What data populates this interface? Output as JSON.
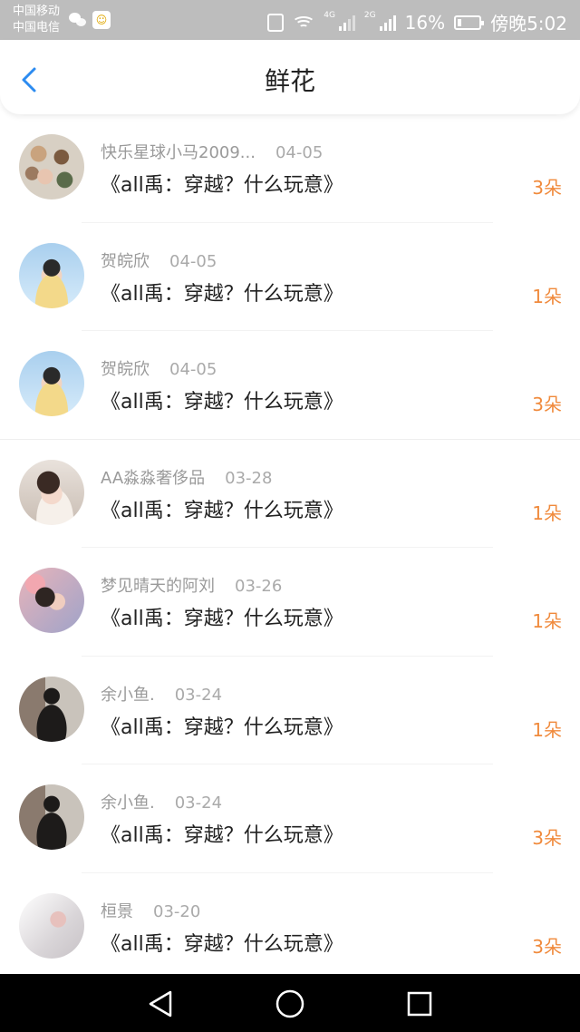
{
  "status_bar": {
    "carrier_1": "中国移动",
    "carrier_2": "中国电信",
    "network_1": "4G",
    "network_2": "2G",
    "battery": "16%",
    "time": "傍晚5:02",
    "icons": [
      "wechat-icon",
      "app-notification-icon",
      "vibrate-icon",
      "wifi-icon",
      "signal-icon",
      "battery-icon"
    ]
  },
  "header": {
    "title": "鲜花",
    "back_icon": "chevron-left-icon",
    "accent": "#2c8bf0"
  },
  "colors": {
    "count": "#f08a3c",
    "meta": "#9a9a9a"
  },
  "records": [
    {
      "user": "快乐星球小马2009...",
      "date": "04-05",
      "book": "《all禹：穿越？什么玩意》",
      "count": "3朵"
    },
    {
      "user": "贺皖欣",
      "date": "04-05",
      "book": "《all禹：穿越？什么玩意》",
      "count": "1朵"
    },
    {
      "user": "贺皖欣",
      "date": "04-05",
      "book": "《all禹：穿越？什么玩意》",
      "count": "3朵"
    },
    {
      "user": "AA淼淼奢侈品",
      "date": "03-28",
      "book": "《all禹：穿越？什么玩意》",
      "count": "1朵"
    },
    {
      "user": "梦见晴天的阿刘",
      "date": "03-26",
      "book": "《all禹：穿越？什么玩意》",
      "count": "1朵"
    },
    {
      "user": "余小鱼.",
      "date": "03-24",
      "book": "《all禹：穿越？什么玩意》",
      "count": "1朵"
    },
    {
      "user": "余小鱼.",
      "date": "03-24",
      "book": "《all禹：穿越？什么玩意》",
      "count": "3朵"
    },
    {
      "user": "桓景",
      "date": "03-20",
      "book": "《all禹：穿越？什么玩意》",
      "count": "3朵"
    }
  ],
  "nav_bar": {
    "icons": [
      "back-triangle-icon",
      "home-circle-icon",
      "recents-square-icon"
    ]
  }
}
